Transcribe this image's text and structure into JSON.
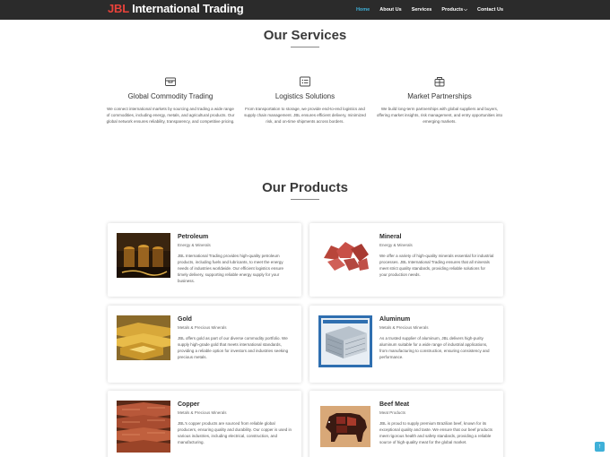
{
  "brand": {
    "accent": "JBL",
    "name": "International Trading"
  },
  "nav": [
    {
      "label": "Home"
    },
    {
      "label": "About Us"
    },
    {
      "label": "Services"
    },
    {
      "label": "Products"
    },
    {
      "label": "Contact Us"
    }
  ],
  "services": {
    "heading": "Our Services",
    "items": [
      {
        "icon": "package-icon",
        "title": "Global Commodity Trading",
        "desc": "We connect international markets by sourcing and trading a wide range of commodities, including energy, metals, and agricultural products. Our global network ensures reliability, transparency, and competitive pricing."
      },
      {
        "icon": "list-icon",
        "title": "Logistics Solutions",
        "desc": "From transportation to storage, we provide end-to-end logistics and supply chain management. JBL ensures efficient delivery, minimized risk, and on-time shipments across borders."
      },
      {
        "icon": "handshake-icon",
        "title": "Market Partnerships",
        "desc": "We build long-term partnerships with global suppliers and buyers, offering market insights, risk management, and entry opportunities into emerging markets."
      }
    ]
  },
  "products": {
    "heading": "Our Products",
    "items": [
      {
        "name": "Petroleum",
        "category": "Energy & Minerals",
        "desc": "JBL International Trading provides high-quality petroleum products, including fuels and lubricants, to meet the energy needs of industries worldwide. Our efficient logistics ensure timely delivery, supporting reliable energy supply for your business."
      },
      {
        "name": "Mineral",
        "category": "Energy & Minerals",
        "desc": "We offer a variety of high-quality minerals essential for industrial processes. JBL International Trading ensures that all minerals meet strict quality standards, providing reliable solutions for your production needs."
      },
      {
        "name": "Gold",
        "category": "Metals & Precious Minerals",
        "desc": "JBL offers gold as part of our diverse commodity portfolio. We supply high-grade gold that meets international standards, providing a reliable option for investors and industries seeking precious metals."
      },
      {
        "name": "Aluminum",
        "category": "Metals & Precious Minerals",
        "desc": "As a trusted supplier of aluminum, JBL delivers high-purity aluminum suitable for a wide range of industrial applications, from manufacturing to construction, ensuring consistency and performance."
      },
      {
        "name": "Copper",
        "category": "Metals & Precious Minerals",
        "desc": "JBL's copper products are sourced from reliable global producers, ensuring quality and durability. Our copper is used in various industries, including electrical, construction, and manufacturing."
      },
      {
        "name": "Beef Meat",
        "category": "Meat Products",
        "desc": "JBL is proud to supply premium Brazilian beef, known for its exceptional quality and taste. We ensure that our beef products meet rigorous health and safety standards, providing a reliable source of high-quality meat for the global market."
      }
    ]
  },
  "back_to_top": "↑"
}
